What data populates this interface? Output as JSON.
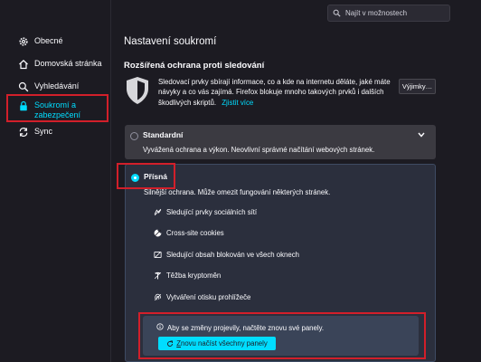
{
  "sidebar": {
    "items": [
      {
        "label": "Obecné",
        "icon": "gear-icon",
        "active": false
      },
      {
        "label": "Domovská stránka",
        "icon": "home-icon",
        "active": false
      },
      {
        "label": "Vyhledávání",
        "icon": "search-icon",
        "active": false
      },
      {
        "label_lines": [
          "Soukromí a",
          "zabezpečení"
        ],
        "icon": "lock-icon",
        "active": true
      },
      {
        "label": "Sync",
        "icon": "sync-icon",
        "active": false
      }
    ]
  },
  "search": {
    "placeholder": "Najít v možnostech",
    "icon": "search-icon"
  },
  "page": {
    "title": "Nastavení soukromí"
  },
  "tracking": {
    "title": "Rozšířená ochrana proti sledování",
    "description": "Sledovací prvky sbírají informace, co a kde na internetu děláte, jaké máte návyky a co vás zajímá. Firefox blokuje mnoho takových prvků i dalších škodlivých skriptů.",
    "learn_more": "Zjistit více",
    "exceptions_button": "Výjimky…",
    "shield_icon": "shield-icon"
  },
  "standard": {
    "label": "Standardní",
    "description": "Vyvážená ochrana a výkon. Neovlivní správné načítání webových stránek.",
    "selected": false
  },
  "strict": {
    "label": "Přísná",
    "description": "Silnější ochrana. Může omezit fungování některých stránek.",
    "selected": true,
    "features": [
      {
        "label": "Sledující prvky sociálních sítí",
        "icon": "social-tracker-icon"
      },
      {
        "label": "Cross-site cookies",
        "icon": "cookie-icon"
      },
      {
        "label": "Sledující obsah blokován ve všech oknech",
        "icon": "tracking-content-icon"
      },
      {
        "label": "Těžba kryptoměn",
        "icon": "cryptominer-icon"
      },
      {
        "label": "Vytváření otisku prohlížeče",
        "icon": "fingerprinter-icon"
      }
    ]
  },
  "notice": {
    "text": "Aby se změny projevily, načtěte znovu své panely.",
    "button_label": "Znovu načíst všechny panely",
    "button_prefix": "Z",
    "button_rest": "novu načíst všechny panely"
  },
  "colors": {
    "accent": "#00ddff",
    "highlight": "#d21f2a",
    "background": "#1c1b22"
  }
}
